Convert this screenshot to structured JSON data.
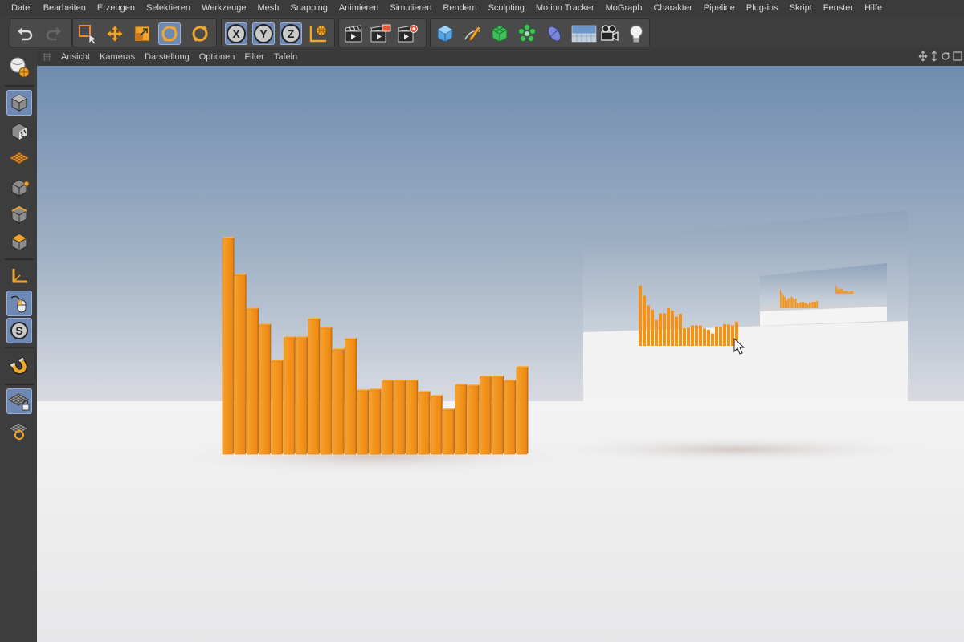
{
  "menu": [
    "Datei",
    "Bearbeiten",
    "Erzeugen",
    "Selektieren",
    "Werkzeuge",
    "Mesh",
    "Snapping",
    "Animieren",
    "Simulieren",
    "Rendern",
    "Sculpting",
    "Motion Tracker",
    "MoGraph",
    "Charakter",
    "Pipeline",
    "Plug-ins",
    "Skript",
    "Fenster",
    "Hilfe"
  ],
  "toolbar": {
    "undo": "undo-icon",
    "redo": "redo-icon",
    "select": "live-selection-icon",
    "move": "move-icon",
    "scale": "scale-icon",
    "rotate": "rotate-icon",
    "recent": "recent-tool-icon",
    "axis_x": "X",
    "axis_y": "Y",
    "axis_z": "Z",
    "coord": "world-coordinates-icon",
    "render_view": "render-view-icon",
    "render_picture": "render-picture-viewer-icon",
    "render_settings": "render-settings-icon",
    "cube": "cube-icon",
    "pen": "spline-pen-icon",
    "subdivision": "subdivision-surface-icon",
    "cloner": "cloner-icon",
    "deformer": "deformer-icon",
    "floor": "floor-icon",
    "camera": "camera-icon",
    "light": "light-icon"
  },
  "left_tools": [
    "make-editable-icon",
    "model-mode-icon",
    "texture-mode-icon",
    "points-mode-icon",
    "edges-mode-icon",
    "polygons-mode-icon",
    "axis-mode-icon",
    "tweak-mode-icon",
    "solo-mode-icon",
    "magnet-icon",
    "workplane-lock-icon",
    "workplane-icon"
  ],
  "viewport_menu": [
    "Ansicht",
    "Kameras",
    "Darstellung",
    "Optionen",
    "Filter",
    "Tafeln"
  ],
  "colors": {
    "accent_active": "#6d88b3",
    "bars": "#f39217",
    "sky_top": "#6f8cae",
    "floor": "#eeeeee"
  },
  "scene": {
    "bar_heights": [
      269,
      223,
      181,
      161,
      116,
      145,
      145,
      168,
      157,
      130,
      143,
      79,
      80,
      91,
      91,
      91,
      77,
      72,
      55,
      86,
      85,
      96,
      96,
      91,
      108
    ]
  }
}
